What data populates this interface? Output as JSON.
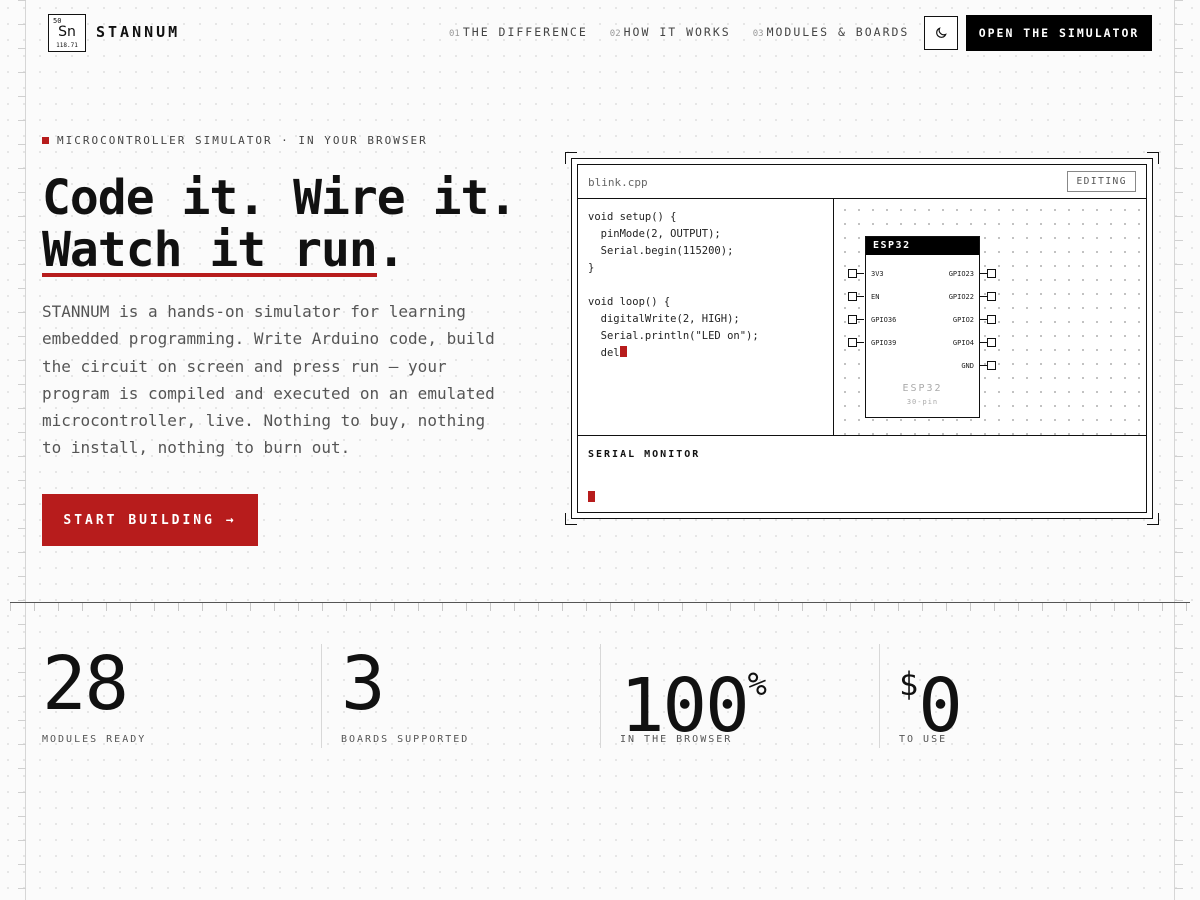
{
  "logo": {
    "number": "50",
    "symbol": "Sn",
    "mass": "118.71"
  },
  "brand": "STANNUM",
  "nav": [
    {
      "index": "01",
      "label": "THE DIFFERENCE"
    },
    {
      "index": "02",
      "label": "HOW IT WORKS"
    },
    {
      "index": "03",
      "label": "MODULES & BOARDS"
    }
  ],
  "theme_icon": "moon-icon",
  "open_simulator_label": "OPEN THE SIMULATOR",
  "hero": {
    "eyebrow": "MICROCONTROLLER SIMULATOR · IN YOUR BROWSER",
    "headline_line1": "Code it. Wire it.",
    "headline_line2": "Watch it run",
    "headline_period": ".",
    "description": "STANNUM is a hands-on simulator for learning embedded programming. Write Arduino code, build the circuit on screen and press run — your program is compiled and executed on an emulated microcontroller, live. Nothing to buy, nothing to install, nothing to burn out.",
    "cta_label": "START BUILDING →",
    "accent_color": "#b71c1c"
  },
  "simulator": {
    "filename": "blink.cpp",
    "status_badge": "EDITING",
    "code": [
      "void setup() {",
      "  pinMode(2, OUTPUT);",
      "  Serial.begin(115200);",
      "}",
      "",
      "void loop() {",
      "  digitalWrite(2, HIGH);",
      "  Serial.println(\"LED on\");",
      "  del"
    ],
    "board": {
      "header": "ESP32",
      "name": "ESP32",
      "subtitle": "30-pin",
      "left_pins": [
        "3V3",
        "EN",
        "GPIO36",
        "GPIO39"
      ],
      "right_pins": [
        "GPIO23",
        "GPIO22",
        "GPIO2",
        "GPIO4",
        "GND"
      ]
    },
    "serial_title": "SERIAL MONITOR"
  },
  "stats": [
    {
      "value": "28",
      "prefix": "",
      "suffix": "",
      "label": "MODULES READY"
    },
    {
      "value": "3",
      "prefix": "",
      "suffix": "",
      "label": "BOARDS SUPPORTED"
    },
    {
      "value": "100",
      "prefix": "",
      "suffix": "%",
      "label": "IN THE BROWSER"
    },
    {
      "value": "0",
      "prefix": "$",
      "suffix": "",
      "label": "TO USE"
    }
  ]
}
